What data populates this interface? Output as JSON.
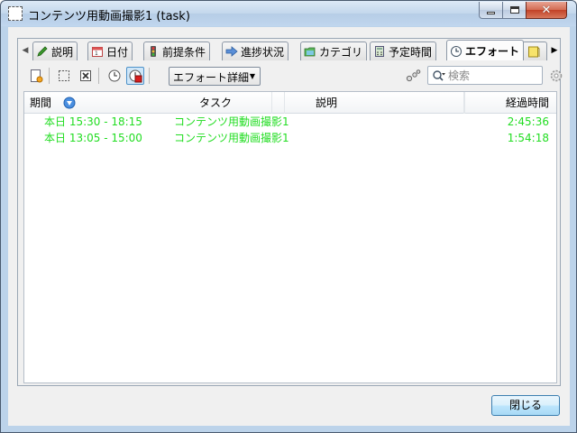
{
  "window": {
    "title": "コンテンツ用動画撮影1 (task)",
    "controls": {
      "minimize": "minimize-icon",
      "maximize": "maximize-icon",
      "close": "close-icon"
    }
  },
  "tabs": [
    {
      "label": "説明",
      "icon": "pencil-icon",
      "active": false
    },
    {
      "label": "日付",
      "icon": "calendar-icon",
      "active": false
    },
    {
      "label": "前提条件",
      "icon": "traffic-light-icon",
      "active": false
    },
    {
      "label": "進捗状況",
      "icon": "progress-arrow-icon",
      "active": false
    },
    {
      "label": "カテゴリ",
      "icon": "folder-icon",
      "active": false
    },
    {
      "label": "予定時間",
      "icon": "calculator-icon",
      "active": false
    },
    {
      "label": "エフォート",
      "icon": "clock-icon",
      "active": true
    },
    {
      "label": "",
      "icon": "note-icon",
      "active": false
    }
  ],
  "toolbar": {
    "view_mode": "エフォート詳細",
    "search_placeholder": "検索"
  },
  "effort_table": {
    "columns": [
      "期間",
      "タスク",
      "説明",
      "経過時間"
    ],
    "sort_column": "期間",
    "rows": [
      {
        "period": "本日 15:30 - 18:15",
        "task": "コンテンツ用動画撮影1",
        "description": "",
        "elapsed": "2:45:36"
      },
      {
        "period": "本日 13:05 - 15:00",
        "task": "コンテンツ用動画撮影1",
        "description": "",
        "elapsed": "1:54:18"
      }
    ],
    "row_color": "#22dd22"
  },
  "footer": {
    "close_label": "閉じる"
  }
}
